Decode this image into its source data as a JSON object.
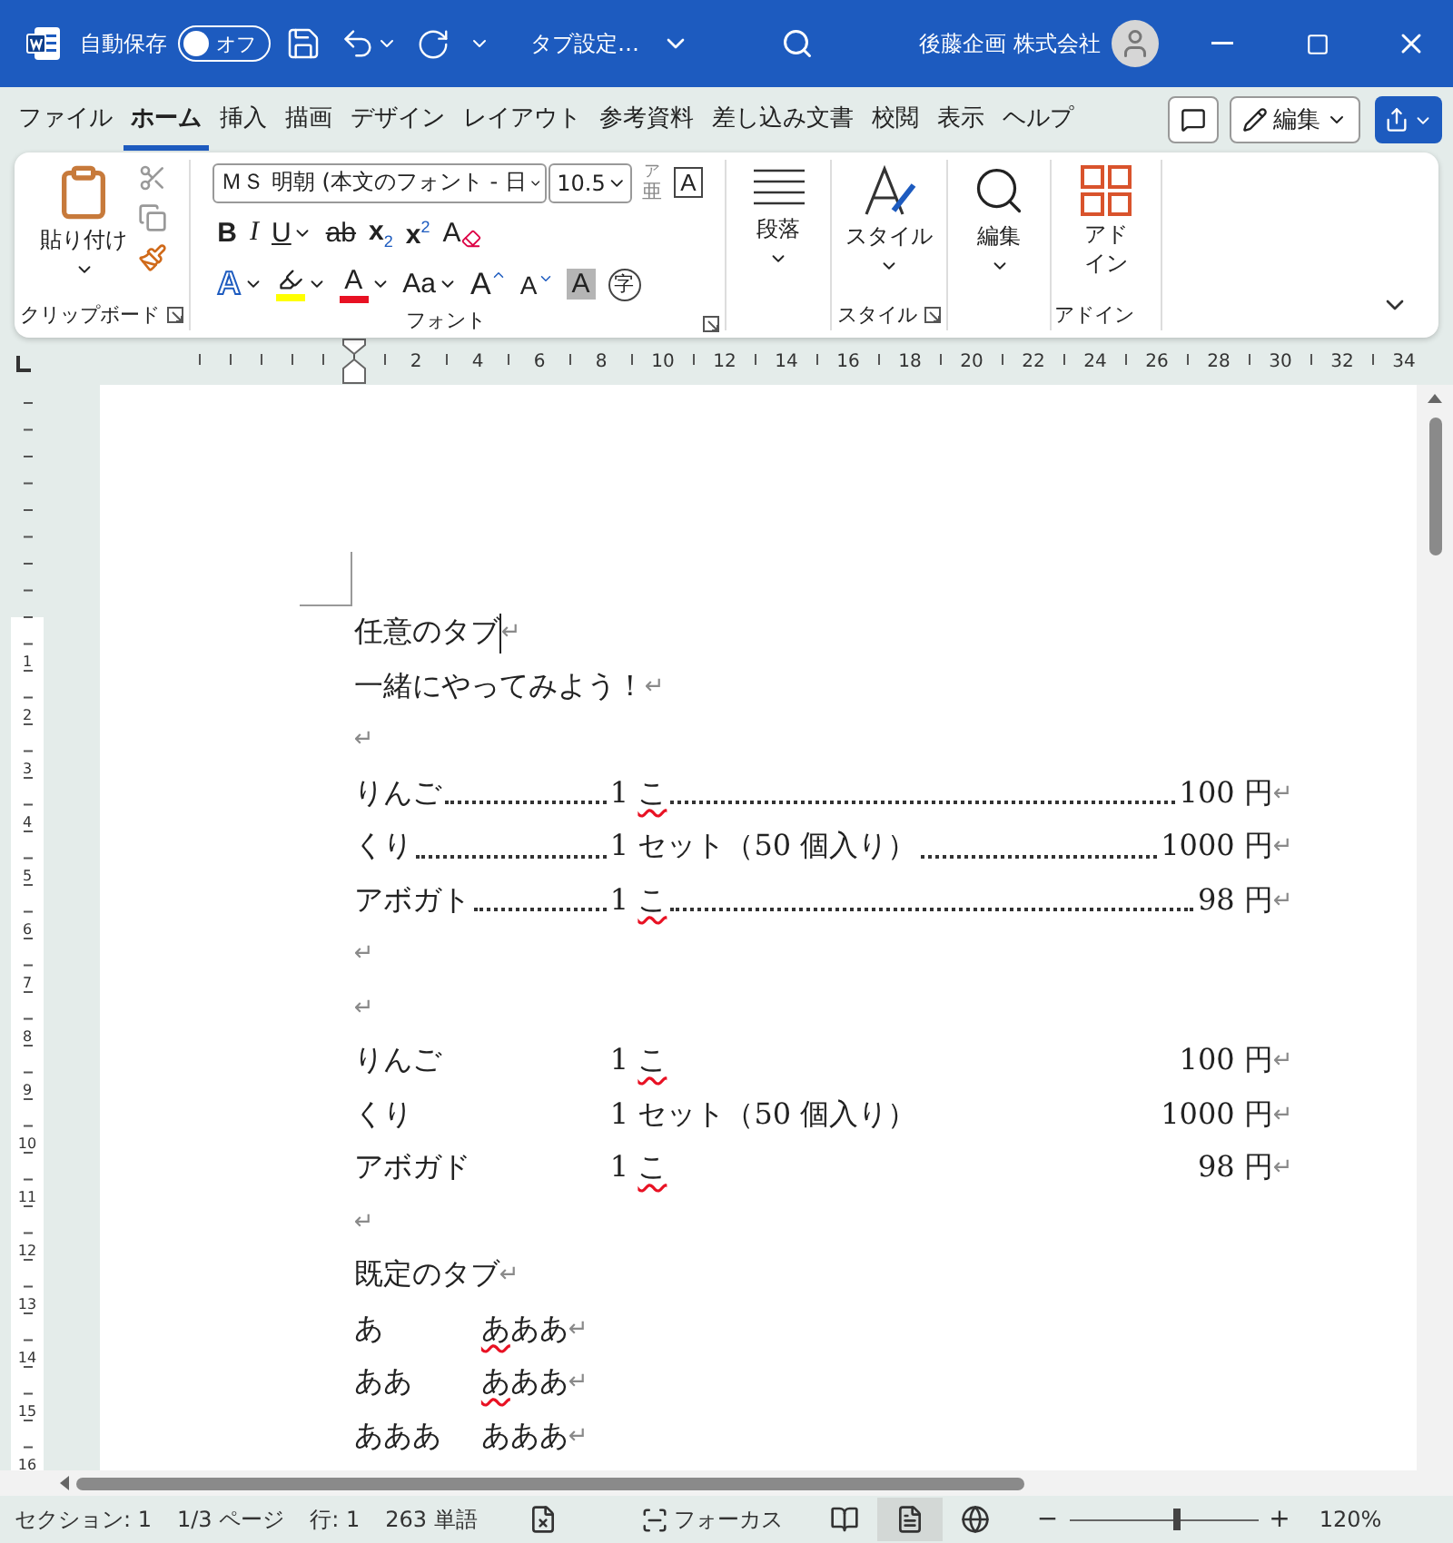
{
  "title_bar": {
    "autosave_label": "自動保存",
    "autosave": {
      "on": false,
      "label": "オフ"
    },
    "doc_title": "タブ設定…",
    "account": "後藤企画 株式会社"
  },
  "menu_tabs": [
    {
      "label": "ファイル",
      "selected": false
    },
    {
      "label": "ホーム",
      "selected": true
    },
    {
      "label": "挿入",
      "selected": false
    },
    {
      "label": "描画",
      "selected": false
    },
    {
      "label": "デザイン",
      "selected": false
    },
    {
      "label": "レイアウト",
      "selected": false
    },
    {
      "label": "参考資料",
      "selected": false
    },
    {
      "label": "差し込み文書",
      "selected": false
    },
    {
      "label": "校閲",
      "selected": false
    },
    {
      "label": "表示",
      "selected": false
    },
    {
      "label": "ヘルプ",
      "selected": false
    }
  ],
  "edit_mode": "編集",
  "ribbon": {
    "groups": [
      {
        "kind": "clipboard",
        "label": "クリップボード",
        "launcher": true,
        "paste": "貼り付け"
      },
      {
        "kind": "font",
        "label": "フォント",
        "launcher": true,
        "font_name": "ＭＳ 明朝 (本文のフォント - 日",
        "font_size": "10.5",
        "phonetic_top": "ア",
        "phonetic_bottom": "亜",
        "border_char": "A",
        "row1": [
          {
            "kind": "bold",
            "label": "B",
            "dropdown": false
          },
          {
            "kind": "italic",
            "label": "I",
            "dropdown": false
          },
          {
            "kind": "underline",
            "label": "U",
            "dropdown": true
          },
          {
            "kind": "strike",
            "label": "ab",
            "dropdown": false
          },
          {
            "kind": "subscript",
            "label": "x",
            "script": "2",
            "dropdown": false
          },
          {
            "kind": "superscript",
            "label": "x",
            "script": "2",
            "dropdown": false
          },
          {
            "kind": "clear",
            "label": "A",
            "dropdown": false
          }
        ],
        "row2": [
          {
            "kind": "effect",
            "label": "A",
            "dropdown": true
          },
          {
            "kind": "highlight",
            "color": "#ffff00",
            "dropdown": true
          },
          {
            "kind": "color",
            "label": "A",
            "color": "#e81123",
            "dropdown": true
          },
          {
            "kind": "case",
            "label": "Aa",
            "dropdown": true
          },
          {
            "kind": "grow",
            "label": "A",
            "dropdown": false
          },
          {
            "kind": "shrink",
            "label": "A",
            "dropdown": false
          },
          {
            "kind": "shade",
            "label": "A",
            "dropdown": false
          },
          {
            "kind": "enclose",
            "label": "字",
            "dropdown": false
          }
        ]
      },
      {
        "kind": "paragraph",
        "button": "段落"
      },
      {
        "kind": "style",
        "label": "スタイル",
        "launcher": true,
        "button": "スタイル"
      },
      {
        "kind": "editing",
        "button": "編集"
      },
      {
        "kind": "addin",
        "label": "アドイン",
        "launcher": false,
        "button": "アドイン"
      }
    ]
  },
  "ruler": {
    "numbers": [
      "2",
      "4",
      "6",
      "8",
      "10",
      "12",
      "14",
      "16",
      "18",
      "20",
      "22",
      "24",
      "26",
      "28",
      "30",
      "32",
      "34"
    ]
  },
  "vertical_ruler": {
    "numbers": [
      "1",
      "2",
      "3",
      "4",
      "5",
      "6",
      "7",
      "8",
      "9",
      "10",
      "11",
      "12",
      "13",
      "14",
      "15",
      "16"
    ]
  },
  "document": {
    "paragraphs": [
      {
        "kind": "text",
        "text": "任意のタブ",
        "cursor": true,
        "mark": "↵"
      },
      {
        "kind": "text",
        "text": "一緒にやってみよう！",
        "cursor": false,
        "mark": "↵"
      },
      {
        "kind": "empty",
        "mark": "↵"
      },
      {
        "kind": "leader",
        "name": "りんご ",
        "qty": [
          {
            "text": "1 ",
            "flagged": false
          },
          {
            "text": "こ",
            "flagged": true
          }
        ],
        "price": "100 円",
        "mark": "↵"
      },
      {
        "kind": "leader",
        "name": "くり",
        "qty": [
          {
            "text": "1 セット（50 個入り）",
            "flagged": false
          }
        ],
        "price": "1000 円",
        "mark": "↵"
      },
      {
        "kind": "leader",
        "name": "アボガト",
        "qty": [
          {
            "text": "1 ",
            "flagged": false
          },
          {
            "text": "こ",
            "flagged": true
          }
        ],
        "price": "98 円",
        "mark": "↵"
      },
      {
        "kind": "empty",
        "mark": "↵"
      },
      {
        "kind": "empty",
        "mark": "↵"
      },
      {
        "kind": "tabbed",
        "name": "りんご",
        "qty": [
          {
            "text": "1 ",
            "flagged": false
          },
          {
            "text": "こ",
            "flagged": true
          }
        ],
        "price": "100 円",
        "mark": "↵"
      },
      {
        "kind": "tabbed",
        "name": "くり",
        "qty": [
          {
            "text": "1 セット（50 個入り）",
            "flagged": false
          }
        ],
        "price": "1000 円",
        "mark": "↵"
      },
      {
        "kind": "tabbed",
        "name": "アボガド",
        "qty": [
          {
            "text": "1 ",
            "flagged": false
          },
          {
            "text": "こ",
            "flagged": true
          }
        ],
        "price": "98 円",
        "mark": "↵"
      },
      {
        "kind": "empty",
        "mark": "↵"
      },
      {
        "kind": "text",
        "text": "既定のタブ",
        "cursor": false,
        "mark": "↵"
      },
      {
        "kind": "pair",
        "left": "あ",
        "right": [
          {
            "text": "あ",
            "flagged": true
          },
          {
            "text": "ああ",
            "flagged": false
          }
        ],
        "mark": "↵"
      },
      {
        "kind": "pair",
        "left": "ああ",
        "right": [
          {
            "text": "あ",
            "flagged": true
          },
          {
            "text": "ああ",
            "flagged": false
          }
        ],
        "mark": "↵"
      },
      {
        "kind": "pair",
        "left": "あああ",
        "right": [
          {
            "text": "あああ",
            "flagged": false
          }
        ],
        "mark": "↵"
      }
    ]
  },
  "status_bar": {
    "section": "セクション: 1",
    "page": "1/3 ページ",
    "line": "行: 1",
    "words": "263 単語",
    "focus": "フォーカス",
    "views": [
      {
        "kind": "read",
        "selected": false
      },
      {
        "kind": "print",
        "selected": true
      },
      {
        "kind": "web",
        "selected": false
      }
    ],
    "zoom_minus": "−",
    "zoom_plus": "+",
    "zoom_slider": {
      "level": 0.57
    },
    "zoom": "120%"
  }
}
